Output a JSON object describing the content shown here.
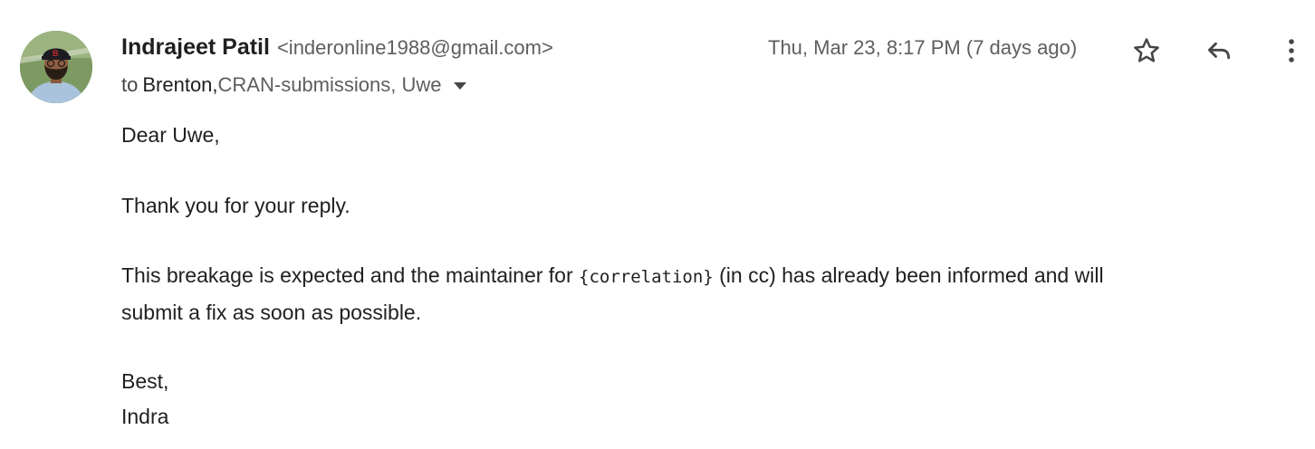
{
  "header": {
    "sender_name": "Indrajeet Patil",
    "sender_email": "<inderonline1988@gmail.com>",
    "timestamp": "Thu, Mar 23, 8:17 PM (7 days ago)",
    "to_label": "to",
    "recipient_first": "Brenton,",
    "recipient_rest": " CRAN-submissions, Uwe",
    "icons": {
      "star": "star-icon",
      "reply": "reply-icon",
      "more": "more-vertical-icon",
      "details": "chevron-down-icon"
    }
  },
  "body": {
    "greeting": "Dear Uwe,",
    "thanks": "Thank you for your reply.",
    "main_before": "This breakage is expected and the maintainer for ",
    "main_code": "{correlation}",
    "main_after": " (in cc) has already been informed and will",
    "main_line2": "submit a fix as soon as possible.",
    "signoff": "Best,",
    "signature": "Indra"
  },
  "colors": {
    "text_primary": "#1f1f1f",
    "text_secondary": "#5e5e5e",
    "icon": "#444746"
  }
}
